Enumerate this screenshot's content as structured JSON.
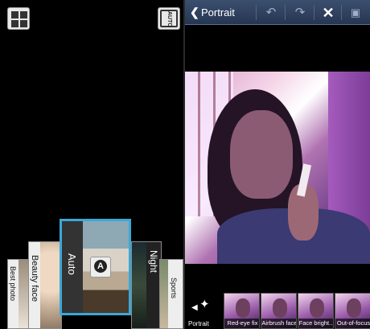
{
  "left_panel": {
    "top_left_icon": "grid-icon",
    "top_right_icon": "auto-mode-icon",
    "top_right_label": "AUTO",
    "modes": [
      {
        "label": "Best photo"
      },
      {
        "label": "Beauty face"
      },
      {
        "label": "Auto",
        "selected": true
      },
      {
        "label": "Night"
      },
      {
        "label": "Sports"
      }
    ],
    "auto_badge": "A",
    "accent_color": "#3aa8d8"
  },
  "right_panel": {
    "header": {
      "back_icon": "chevron-left-icon",
      "title": "Portrait",
      "undo_icon": "undo-icon",
      "redo_icon": "redo-icon",
      "close_icon": "close-icon",
      "save_icon": "save-icon"
    },
    "bottom_bar": {
      "mode_label": "Portrait",
      "mode_icon": "magic-wand-icon",
      "effects": [
        {
          "label": "Red-eye fix"
        },
        {
          "label": "Airbrush face"
        },
        {
          "label": "Face bright..."
        },
        {
          "label": "Out-of-focus"
        }
      ]
    },
    "header_color": "#2f4260"
  }
}
